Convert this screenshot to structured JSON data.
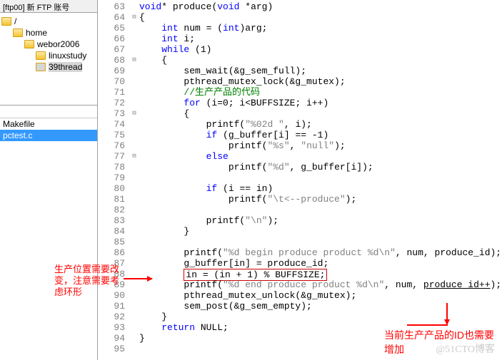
{
  "tab": {
    "title": "[ftp00] 新 FTP 账号"
  },
  "tree": {
    "items": [
      {
        "label": "/",
        "indent": 0
      },
      {
        "label": "home",
        "indent": 1
      },
      {
        "label": "webor2006",
        "indent": 2
      },
      {
        "label": "linuxstudy",
        "indent": 3
      },
      {
        "label": "39thread",
        "indent": 3,
        "selected": true
      }
    ]
  },
  "files": {
    "items": [
      {
        "label": "Makefile",
        "selected": false
      },
      {
        "label": "pctest.c",
        "selected": true
      }
    ]
  },
  "code": {
    "first_line": 63,
    "lines": [
      {
        "n": 63,
        "html": "<span class='typ'>void</span>* <span class='fn'>produce</span>(<span class='typ'>void</span> *arg)"
      },
      {
        "n": 64,
        "fold": "⊟",
        "html": "{"
      },
      {
        "n": 65,
        "html": "    <span class='typ'>int</span> num = (<span class='typ'>int</span>)arg;"
      },
      {
        "n": 66,
        "html": "    <span class='typ'>int</span> i;"
      },
      {
        "n": 67,
        "html": "    <span class='kw'>while</span> (1)"
      },
      {
        "n": 68,
        "fold": "⊟",
        "html": "    {"
      },
      {
        "n": 69,
        "html": "        sem_wait(&amp;g_sem_full);"
      },
      {
        "n": 70,
        "html": "        pthread_mutex_lock(&amp;g_mutex);"
      },
      {
        "n": 71,
        "html": "        <span class='cmt'>//生产产品的代码</span>"
      },
      {
        "n": 72,
        "html": "        <span class='kw'>for</span> (i=0; i&lt;BUFFSIZE; i++)"
      },
      {
        "n": 73,
        "fold": "⊟",
        "html": "        {"
      },
      {
        "n": 74,
        "html": "            printf(<span class='str'>\"%02d \"</span>, i);"
      },
      {
        "n": 75,
        "html": "            <span class='kw'>if</span> (g_buffer[i] == -1)"
      },
      {
        "n": 76,
        "html": "                printf(<span class='str'>\"%s\"</span>, <span class='str'>\"null\"</span>);"
      },
      {
        "n": 77,
        "fold": "⊟",
        "html": "            <span class='kw'>else</span>"
      },
      {
        "n": 78,
        "html": "                printf(<span class='str'>\"%d\"</span>, g_buffer[i]);"
      },
      {
        "n": 79,
        "html": ""
      },
      {
        "n": 80,
        "html": "            <span class='kw'>if</span> (i == in)"
      },
      {
        "n": 81,
        "html": "                printf(<span class='str'>\"\\t&lt;--produce\"</span>);"
      },
      {
        "n": 82,
        "html": ""
      },
      {
        "n": 83,
        "html": "            printf(<span class='str'>\"\\n\"</span>);"
      },
      {
        "n": 84,
        "html": "        }"
      },
      {
        "n": 85,
        "html": ""
      },
      {
        "n": 86,
        "html": "        printf(<span class='str'>\"%d begin produce product %d\\n\"</span>, num, produce_id);"
      },
      {
        "n": 87,
        "html": "        g_buffer[in] = produce_id;"
      },
      {
        "n": 88,
        "html": "        <span class='boxed'>in = (in + 1) % BUFFSIZE;</span>"
      },
      {
        "n": 89,
        "html": "        printf(<span class='str'>\"%d end produce product %d\\n\"</span>, num, <u>produce_id++</u>);"
      },
      {
        "n": 90,
        "html": "        pthread_mutex_unlock(&amp;g_mutex);"
      },
      {
        "n": 91,
        "html": "        sem_post(&amp;g_sem_empty);"
      },
      {
        "n": 92,
        "html": "    }"
      },
      {
        "n": 93,
        "html": "    <span class='kw'>return</span> NULL;"
      },
      {
        "n": 94,
        "html": "}"
      },
      {
        "n": 95,
        "html": ""
      }
    ]
  },
  "annotations": {
    "anno1": "生产位置需要改变，注意需要考虑环形",
    "anno2": "当前生产产品的ID也需要增加"
  },
  "watermark": "@51CTO博客"
}
